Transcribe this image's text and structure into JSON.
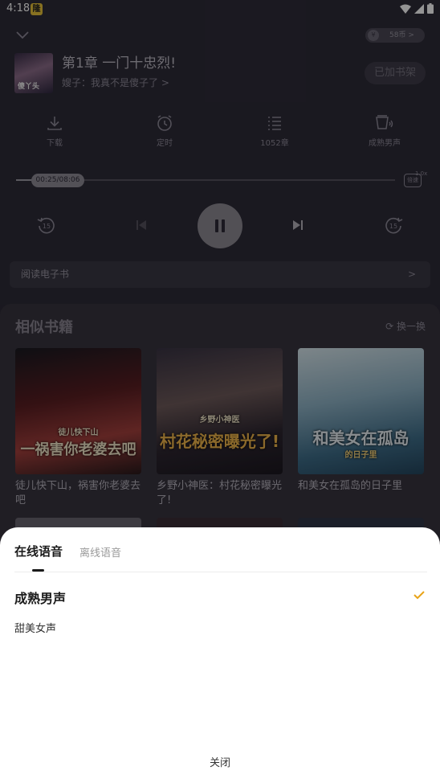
{
  "status_bar": {
    "time": "4:18",
    "badge": "隆"
  },
  "player": {
    "coins_label": "58币 >",
    "coin_symbol": "¥",
    "cover_text": "傻丫头",
    "chapter_title": "第1章 一门十忠烈!",
    "book_link": "嫂子：我真不是傻子了 >",
    "shelf_button": "已加书架",
    "actions": [
      {
        "label": "下载"
      },
      {
        "label": "定时"
      },
      {
        "label": "1052章"
      },
      {
        "label": "成熟男声"
      }
    ],
    "progress": {
      "time_label": "00:25/08:06",
      "fraction": 0.051
    },
    "speed_label": "倍速",
    "speed_value": "1.0x",
    "rewind_label": "15",
    "forward_label": "15",
    "read_ebook": "阅读电子书",
    "read_ebook_arrow": ">"
  },
  "similar": {
    "title": "相似书籍",
    "refresh": "换一换",
    "books": [
      {
        "cover_text": "一祸害你老婆去吧",
        "cover_sub": "徒儿快下山",
        "title": "徒儿快下山，祸害你老婆去吧"
      },
      {
        "cover_text": "村花秘密曝光了!",
        "cover_sub": "乡野小神医",
        "title": "乡野小神医：村花秘密曝光了!"
      },
      {
        "cover_text": "和美女在孤岛",
        "cover_sub": "的日子里",
        "title": "和美女在孤岛的日子里"
      }
    ]
  },
  "sheet": {
    "tabs": [
      {
        "label": "在线语音"
      },
      {
        "label": "离线语音"
      }
    ],
    "voices": [
      {
        "label": "成熟男声",
        "selected": true
      },
      {
        "label": "甜美女声",
        "selected": false
      }
    ],
    "close": "关闭"
  },
  "colors": {
    "accent": "#e8a317",
    "sheet_bg": "#ffffff",
    "player_bg": "#2e2b38"
  }
}
